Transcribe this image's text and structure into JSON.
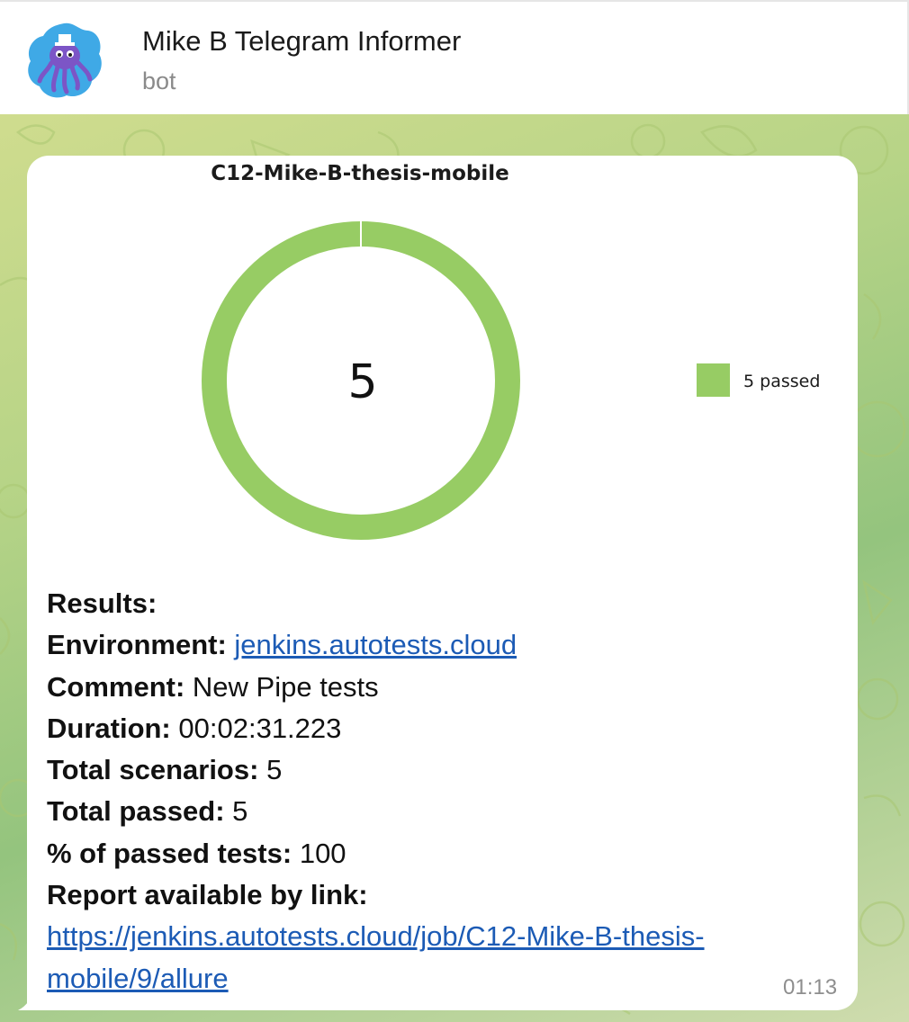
{
  "header": {
    "title": "Mike B Telegram Informer",
    "subtitle": "bot"
  },
  "chart_data": {
    "type": "pie",
    "title": "C12-Mike-B-thesis-mobile",
    "center_label": "5",
    "categories": [
      "passed"
    ],
    "values": [
      5
    ],
    "colors": [
      "#97cc64"
    ],
    "legend": [
      "5 passed"
    ],
    "legend_position": "right"
  },
  "message": {
    "results_label": "Results:",
    "environment_label": "Environment:",
    "environment_value": "jenkins.autotests.cloud",
    "comment_label": "Comment:",
    "comment_value": "New Pipe tests",
    "duration_label": "Duration:",
    "duration_value": "00:02:31.223",
    "total_scenarios_label": "Total scenarios:",
    "total_scenarios_value": "5",
    "total_passed_label": "Total passed:",
    "total_passed_value": "5",
    "percent_label": "% of passed tests:",
    "percent_value": "100",
    "report_label": "Report available by link:",
    "report_link_line1": "https://jenkins.autotests.cloud/job/C12-Mike-B-thesis-",
    "report_link_line2": "mobile/9/allure",
    "time": "01:13"
  },
  "colors": {
    "link": "#1c5bb5",
    "passed": "#97cc64",
    "avatar_bg": "#3fa9e6"
  }
}
